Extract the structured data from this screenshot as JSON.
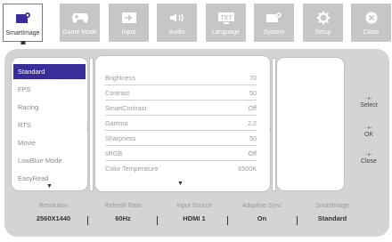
{
  "tabs": [
    {
      "label": "SmartImage",
      "icon": "smartimage-icon"
    },
    {
      "label": "Game Mode",
      "icon": "gamepad-icon"
    },
    {
      "label": "Input",
      "icon": "input-icon"
    },
    {
      "label": "Audio",
      "icon": "speaker-icon"
    },
    {
      "label": "Language",
      "icon": "language-icon"
    },
    {
      "label": "System",
      "icon": "system-icon"
    },
    {
      "label": "Setup",
      "icon": "gear-icon"
    },
    {
      "label": "Close",
      "icon": "close-icon"
    }
  ],
  "modes": [
    "Standard",
    "FPS",
    "Racing",
    "RTS",
    "Movie",
    "LowBlue Mode",
    "EasyRead"
  ],
  "settings": [
    {
      "label": "Brightness",
      "value": "70"
    },
    {
      "label": "Contrast",
      "value": "50"
    },
    {
      "label": "SmartContrast",
      "value": "Off"
    },
    {
      "label": "Gamma",
      "value": "2.2"
    },
    {
      "label": "Sharpness",
      "value": "50"
    },
    {
      "label": "sRGB",
      "value": "Off"
    },
    {
      "label": "Color Temperature",
      "value": "6500K"
    }
  ],
  "controls": [
    "Select",
    "OK",
    "Close"
  ],
  "status": [
    {
      "label": "Resolution",
      "value": "2560X1440"
    },
    {
      "label": "Refresh Rate",
      "value": "60Hz"
    },
    {
      "label": "Input Source",
      "value": "HDMI 1"
    },
    {
      "label": "Adaptive Sync",
      "value": "On"
    },
    {
      "label": "SmartImage",
      "value": "Standard"
    }
  ],
  "colors": {
    "accent": "#3b2d99",
    "tab_bg": "#c6c6c6",
    "shell_bg": "#d4d4d4"
  }
}
